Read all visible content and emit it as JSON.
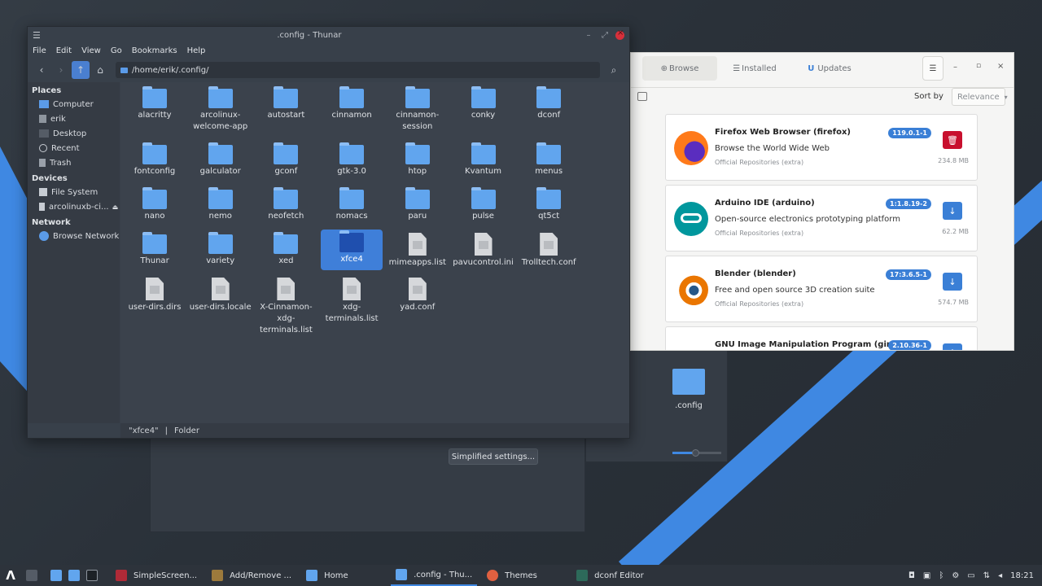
{
  "thunar": {
    "title": ".config - Thunar",
    "menus": [
      "File",
      "Edit",
      "View",
      "Go",
      "Bookmarks",
      "Help"
    ],
    "path": "/home/erik/.config/",
    "sidebar": {
      "places_header": "Places",
      "places": [
        "Computer",
        "erik",
        "Desktop",
        "Recent",
        "Trash"
      ],
      "devices_header": "Devices",
      "devices": [
        "File System",
        "arcolinuxb-ci..."
      ],
      "network_header": "Network",
      "network": [
        "Browse Network"
      ]
    },
    "files": [
      [
        "alacritty"
      ],
      [
        "arcolinux-",
        "welcome-app"
      ],
      [
        "autostart"
      ],
      [
        "cinnamon"
      ],
      [
        "cinnamon-",
        "session"
      ],
      [
        "conky"
      ],
      [
        "dconf"
      ],
      [
        "fontconfig"
      ],
      [
        "galculator"
      ],
      [
        "gconf"
      ],
      [
        "gtk-3.0"
      ],
      [
        "htop"
      ],
      [
        "Kvantum"
      ],
      [
        "menus"
      ],
      [
        "nano"
      ],
      [
        "nemo"
      ],
      [
        "neofetch"
      ],
      [
        "nomacs"
      ],
      [
        "paru"
      ],
      [
        "pulse"
      ],
      [
        "qt5ct"
      ],
      [
        "Thunar"
      ],
      [
        "variety"
      ],
      [
        "xed"
      ],
      [
        "xfce4"
      ],
      [
        "mimeapps.list"
      ],
      [
        "pavucontrol.ini"
      ],
      [
        "Trolltech.conf"
      ],
      [
        "user-dirs.dirs"
      ],
      [
        "user-dirs.locale"
      ],
      [
        "X-Cinnamon-",
        "xdg-",
        "terminals.list"
      ],
      [
        "xdg-",
        "terminals.list"
      ],
      [
        "yad.conf"
      ]
    ],
    "status_name": "\"xfce4\"",
    "status_sep": "|",
    "status_type": "Folder"
  },
  "pamac": {
    "tabs": [
      "Browse",
      "Installed",
      "Updates"
    ],
    "sort_label": "Sort by",
    "sort_value": "Relevance",
    "packages": [
      {
        "name": "Firefox Web Browser (firefox)",
        "desc": "Browse the World Wide Web",
        "repo": "Official Repositories (extra)",
        "version": "119.0.1-1",
        "size": "234.8 MB",
        "action": "remove"
      },
      {
        "name": "Arduino IDE (arduino)",
        "desc": "Open-source electronics prototyping platform",
        "repo": "Official Repositories (extra)",
        "version": "1:1.8.19-2",
        "size": "62.2 MB",
        "action": "install"
      },
      {
        "name": "Blender (blender)",
        "desc": "Free and open source 3D creation suite",
        "repo": "Official Repositories (extra)",
        "version": "17:3.6.5-1",
        "size": "574.7 MB",
        "action": "install"
      },
      {
        "name": "GNU Image Manipulation Program (gimp)",
        "desc": "",
        "repo": "",
        "version": "2.10.36-1",
        "size": "",
        "action": "install"
      }
    ]
  },
  "desktop": {
    "icon_label": ".config",
    "simplified_button": "Simplified settings..."
  },
  "taskbar": {
    "apps": [
      "SimpleScreen...",
      "Add/Remove ...",
      "Home",
      ".config - Thu...",
      "Themes",
      "dconf Editor"
    ],
    "clock": "18:21"
  },
  "colors": {
    "accent": "#3f88e2",
    "remove": "#c8102e",
    "install": "#3a7fd6"
  }
}
